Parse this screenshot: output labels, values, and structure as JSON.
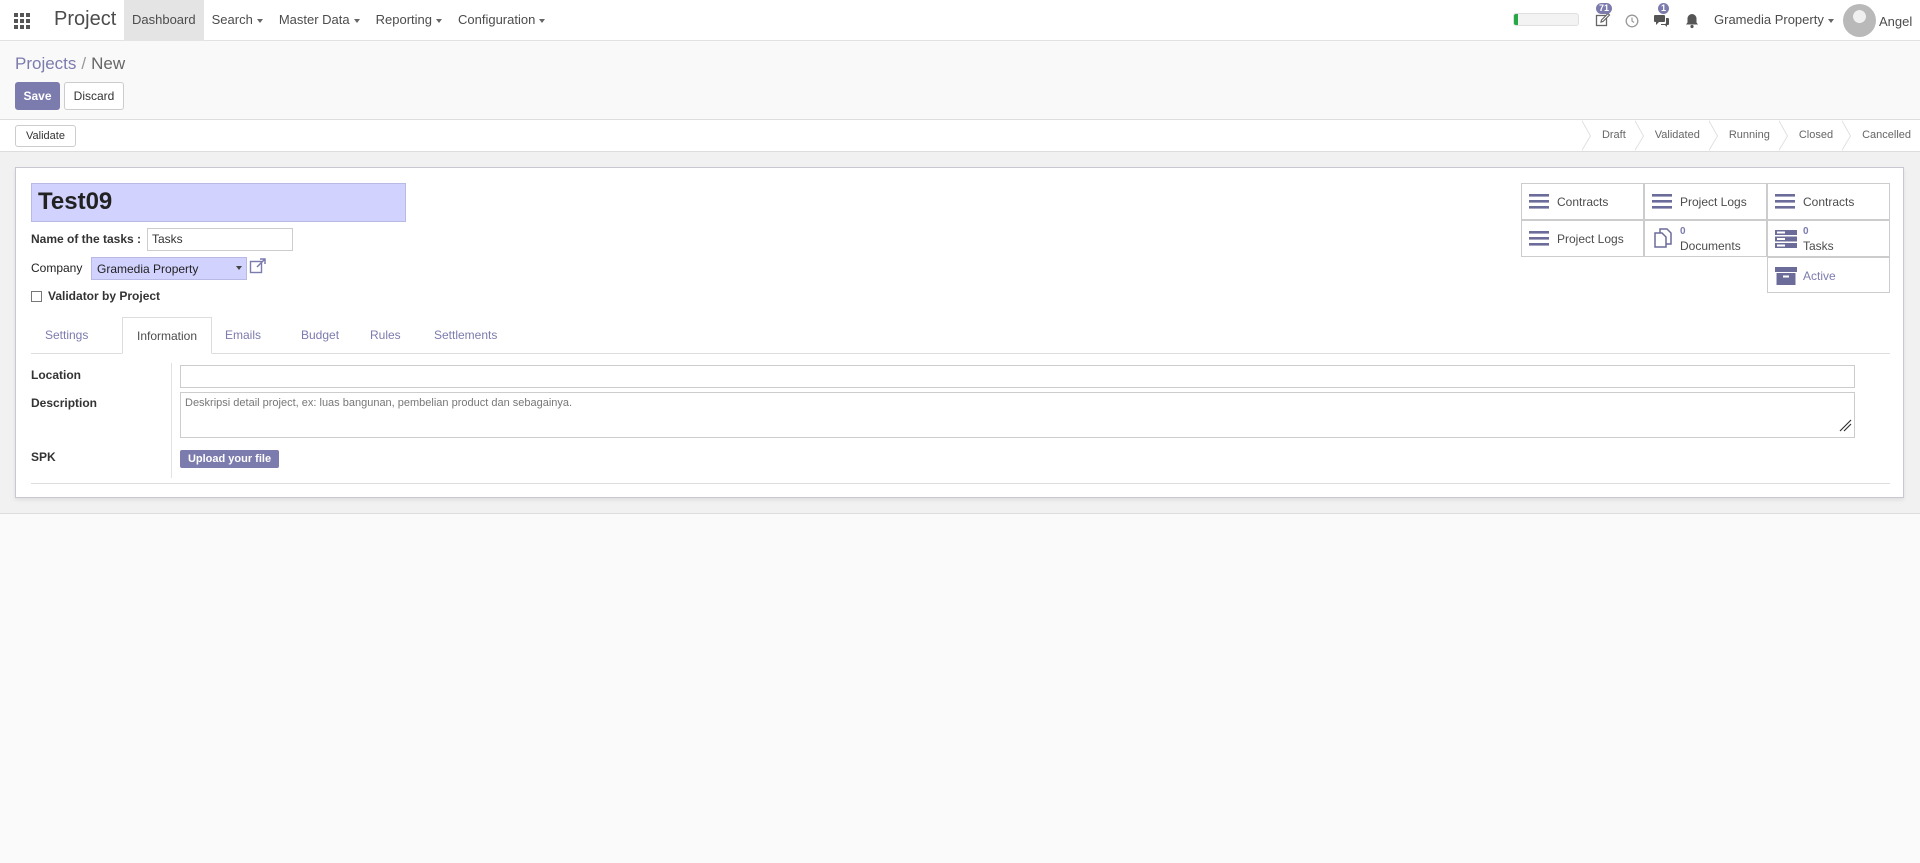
{
  "navbar": {
    "app_name": "Project",
    "menu": [
      {
        "label": "Dashboard",
        "active": true,
        "dropdown": false
      },
      {
        "label": "Search",
        "dropdown": true
      },
      {
        "label": "Master Data",
        "dropdown": true
      },
      {
        "label": "Reporting",
        "dropdown": true
      },
      {
        "label": "Configuration",
        "dropdown": true
      }
    ],
    "progress_fraction": 0.06,
    "activities_badge": "71",
    "messages_badge": "1",
    "company": "Gramedia Property",
    "user": "Angel",
    "icons": [
      "apps-icon",
      "edit-icon",
      "clock-icon",
      "chat-icon",
      "bell-icon"
    ]
  },
  "breadcrumb": {
    "parent": "Projects",
    "separator": "/",
    "current": "New"
  },
  "buttons": {
    "save": "Save",
    "discard": "Discard",
    "validate": "Validate",
    "upload": "Upload your file"
  },
  "stages": [
    "Draft",
    "Validated",
    "Running",
    "Closed",
    "Cancelled"
  ],
  "form": {
    "name": "Test09",
    "task_name_label": "Name of the tasks :",
    "task_name_value": "Tasks",
    "company_label": "Company",
    "company_value": "Gramedia Property",
    "validator_label": "Validator by Project",
    "validator_checked": false
  },
  "stat_buttons": {
    "contracts_1": "Contracts",
    "project_logs_1": "Project Logs",
    "contracts_2": "Contracts",
    "project_logs_2": "Project Logs",
    "documents_count": "0",
    "documents_label": "Documents",
    "tasks_count": "0",
    "tasks_label": "Tasks",
    "active_label": "Active"
  },
  "tabs": [
    {
      "label": "Settings",
      "active": false
    },
    {
      "label": "Information",
      "active": true
    },
    {
      "label": "Emails",
      "active": false
    },
    {
      "label": "Budget",
      "active": false
    },
    {
      "label": "Rules",
      "active": false
    },
    {
      "label": "Settlements",
      "active": false
    }
  ],
  "information": {
    "location_label": "Location",
    "location_value": "",
    "description_label": "Description",
    "description_placeholder": "Deskripsi detail project, ex: luas bangunan, pembelian product dan sebagainya.",
    "spk_label": "SPK"
  },
  "colors": {
    "primary": "#7c7bad",
    "highlight_field": "#d2d2ff",
    "progress": "#28a745"
  }
}
